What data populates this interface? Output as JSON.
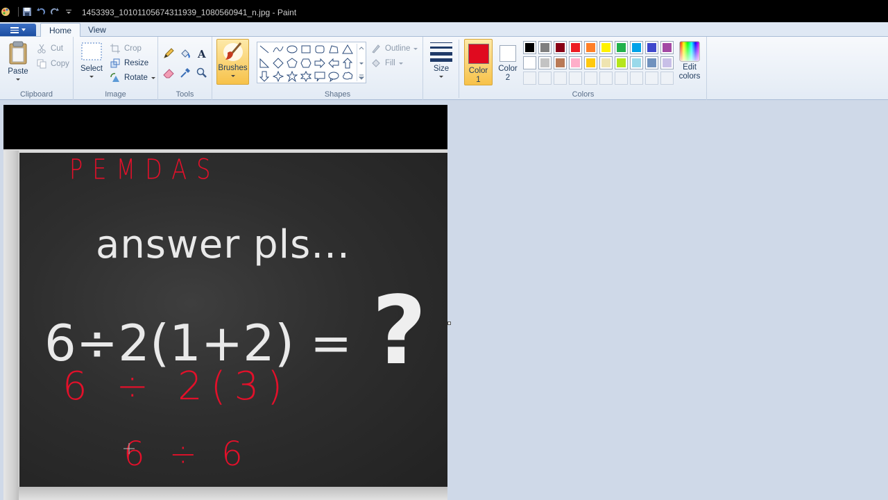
{
  "window": {
    "title": "1453393_10101105674311939_1080560941_n.jpg - Paint"
  },
  "tabs": [
    {
      "label": "Home",
      "active": true
    },
    {
      "label": "View",
      "active": false
    }
  ],
  "ribbon": {
    "clipboard": {
      "group_label": "Clipboard",
      "paste_label": "Paste",
      "cut_label": "Cut",
      "copy_label": "Copy"
    },
    "image": {
      "group_label": "Image",
      "select_label": "Select",
      "crop_label": "Crop",
      "resize_label": "Resize",
      "rotate_label": "Rotate"
    },
    "tools": {
      "group_label": "Tools"
    },
    "brushes": {
      "label": "Brushes"
    },
    "shapes": {
      "group_label": "Shapes",
      "outline_label": "Outline",
      "fill_label": "Fill"
    },
    "size": {
      "label": "Size"
    },
    "colors": {
      "group_label": "Colors",
      "color1_label": "Color 1",
      "color1_line1": "Color",
      "color1_line2": "1",
      "color1_value": "#e00a1f",
      "color2_line1": "Color",
      "color2_line2": "2",
      "color2_value": "#ffffff",
      "edit_line1": "Edit",
      "edit_line2": "colors",
      "palette_row1": [
        "#000000",
        "#7f7f7f",
        "#880015",
        "#ed1c24",
        "#ff7f27",
        "#fff200",
        "#22b14c",
        "#00a2e8",
        "#3f48cc",
        "#a349a4"
      ],
      "palette_row2": [
        "#ffffff",
        "#c3c3c3",
        "#b97a57",
        "#ffaec9",
        "#ffc90e",
        "#efe4b0",
        "#b5e61d",
        "#99d9ea",
        "#7092be",
        "#c8bfe7"
      ]
    }
  },
  "image": {
    "chalk_heading": "answer pls...",
    "chalk_equation": "6÷2(1+2) =",
    "chalk_question": "?",
    "red_annotations": {
      "pemdas": "PEMDAS",
      "line1": "6 ÷ 2(3)",
      "line2": "6 ÷ 6"
    }
  }
}
